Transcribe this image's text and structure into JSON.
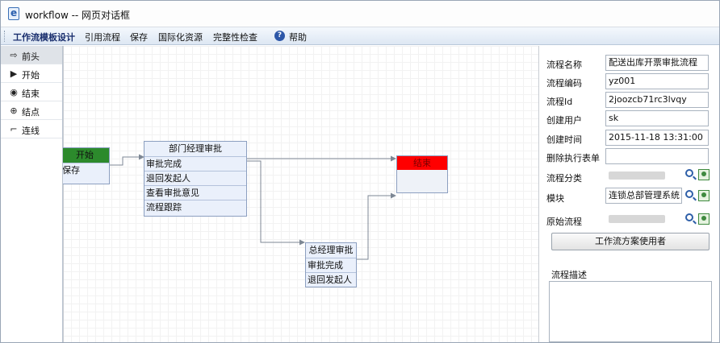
{
  "window": {
    "title": "workflow -- 网页对话框"
  },
  "menu": {
    "items": [
      "工作流模板设计",
      "引用流程",
      "保存",
      "国际化资源",
      "完整性检查"
    ],
    "help_icon_glyph": "?",
    "help_label": "帮助"
  },
  "toolbox": {
    "items": [
      {
        "label": "前头",
        "icon": "arrow-icon",
        "glyph": "⇨",
        "selected": true
      },
      {
        "label": "开始",
        "icon": "start-icon",
        "glyph": "▶",
        "selected": false
      },
      {
        "label": "结束",
        "icon": "end-icon",
        "glyph": "◉",
        "selected": false
      },
      {
        "label": "结点",
        "icon": "node-icon",
        "glyph": "⊕",
        "selected": false
      },
      {
        "label": "连线",
        "icon": "connector-icon",
        "glyph": "⌐",
        "selected": false
      }
    ]
  },
  "canvas": {
    "start_node": {
      "title": "开始",
      "rows": [
        "保存"
      ],
      "header_color": "#2c8a2c"
    },
    "dept_node": {
      "title": "部门经理审批",
      "rows": [
        "审批完成",
        "退回发起人",
        "查看审批意见",
        "流程跟踪"
      ]
    },
    "gm_node": {
      "title": "总经理审批",
      "rows": [
        "审批完成",
        "退回发起人"
      ]
    },
    "end_node": {
      "title": "结束",
      "header_color": "#ff0000"
    }
  },
  "properties": {
    "fields": [
      {
        "label": "流程名称",
        "value": "配送出库开票审批流程"
      },
      {
        "label": "流程编码",
        "value": "yz001"
      },
      {
        "label": "流程Id",
        "value": "2joozcb71rc3lvqy"
      },
      {
        "label": "创建用户",
        "value": "sk"
      },
      {
        "label": "创建时间",
        "value": "2015-11-18 13:31:00"
      },
      {
        "label": "删除执行表单",
        "value": ""
      }
    ],
    "lookups": [
      {
        "label": "流程分类",
        "value": ""
      },
      {
        "label": "模块",
        "value": "连锁总部管理系统"
      },
      {
        "label": "原始流程",
        "value": ""
      }
    ],
    "users_button": "工作流方案使用者",
    "description_label": "流程描述"
  }
}
